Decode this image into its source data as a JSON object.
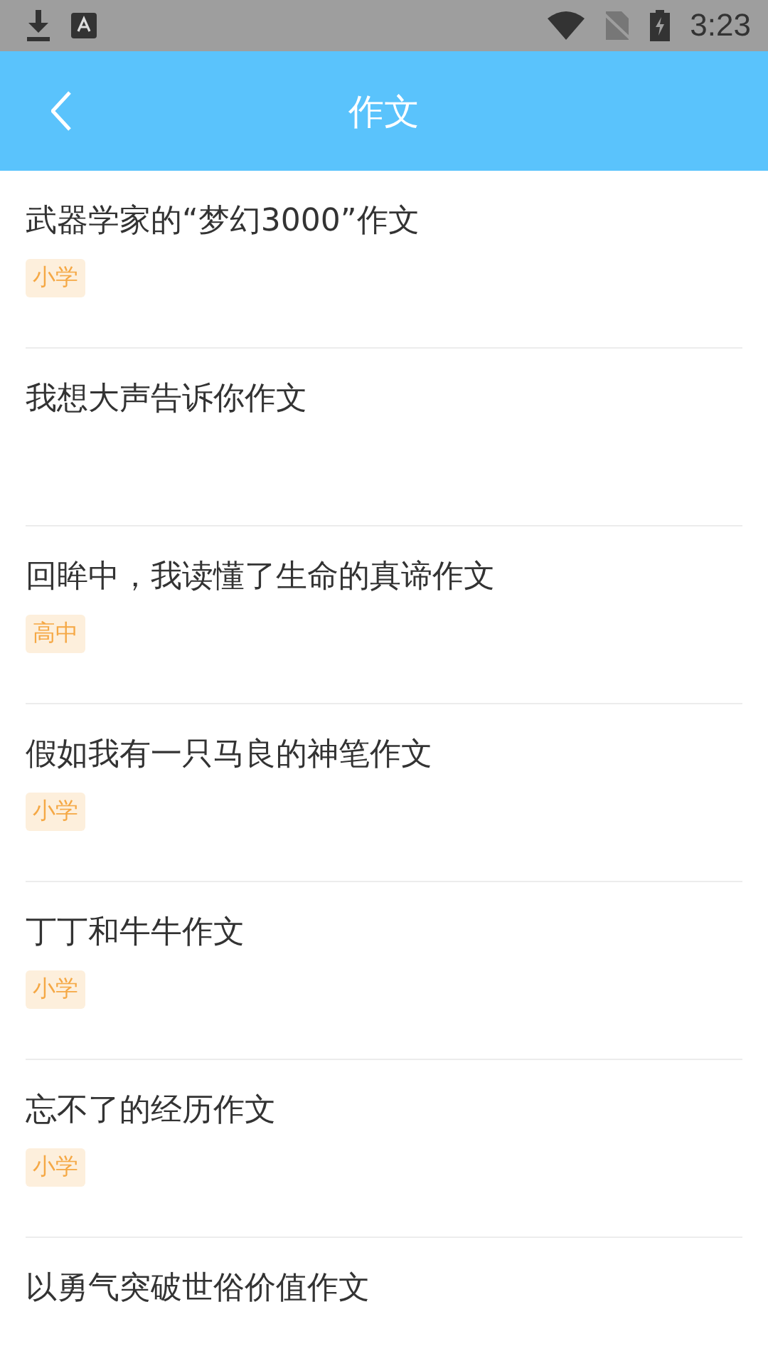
{
  "status_bar": {
    "time": "3:23"
  },
  "header": {
    "title": "作文"
  },
  "articles": [
    {
      "title": "武器学家的“梦幻3000”作文",
      "tag": "小学"
    },
    {
      "title": "我想大声告诉你作文"
    },
    {
      "title": "回眸中，我读懂了生命的真谛作文",
      "tag": "高中"
    },
    {
      "title": "假如我有一只马良的神笔作文",
      "tag": "小学"
    },
    {
      "title": "丁丁和牛牛作文",
      "tag": "小学"
    },
    {
      "title": "忘不了的经历作文",
      "tag": "小学"
    },
    {
      "title": "以勇气突破世俗价值作文"
    }
  ]
}
